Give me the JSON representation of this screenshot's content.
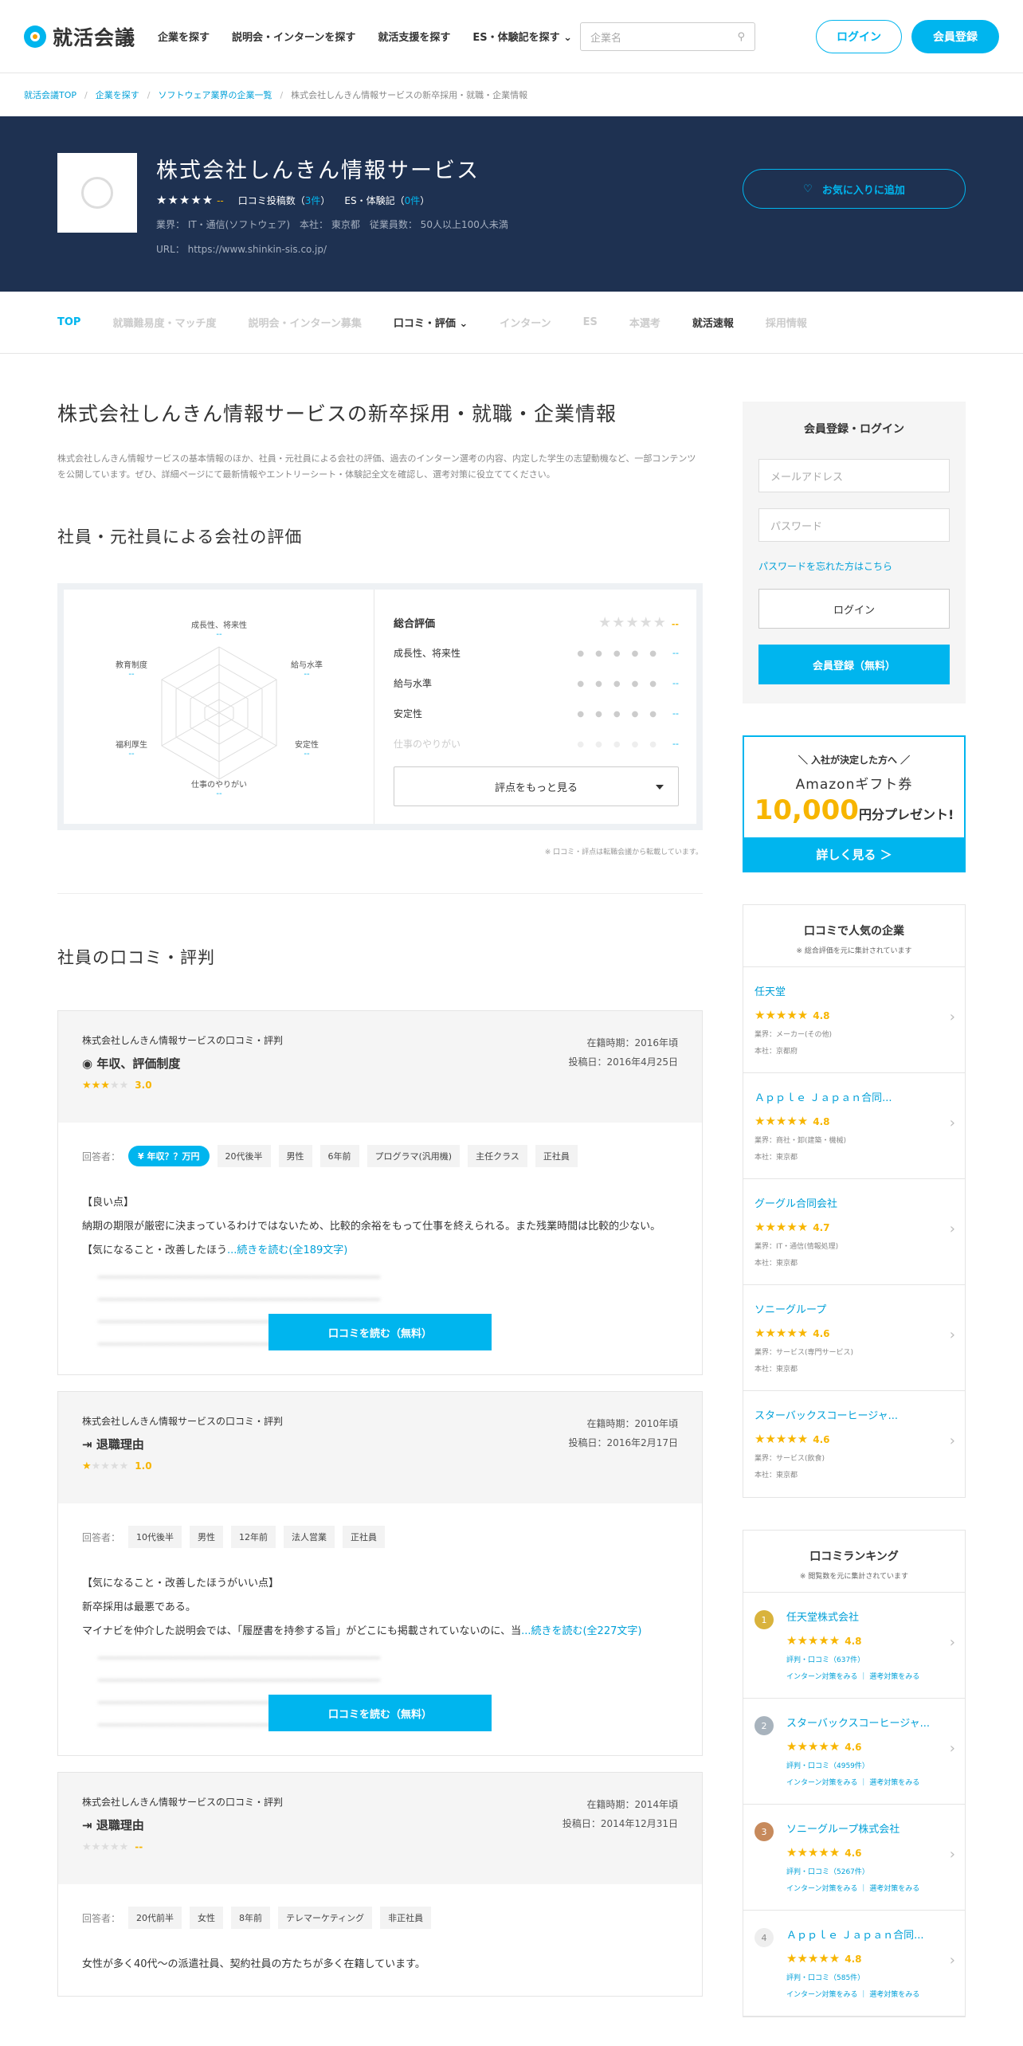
{
  "header": {
    "logo_text": "就活会議",
    "nav": [
      "企業を探す",
      "説明会・インターンを探す",
      "就活支援を探す",
      "ES・体験記を探す"
    ],
    "search_placeholder": "企業名",
    "login": "ログイン",
    "register": "会員登録"
  },
  "breadcrumb": [
    "就活会議TOP",
    "企業を探す",
    "ソフトウェア業界の企業一覧",
    "株式会社しんきん情報サービスの新卒採用・就職・企業情報"
  ],
  "company": {
    "name": "株式会社しんきん情報サービス",
    "rating_stars": "★★★★★",
    "rating_value": "--",
    "review_label": "口コミ投稿数（",
    "review_count": "3件",
    "review_close": "）",
    "es_label": "ES・体験記（",
    "es_count": "0件",
    "es_close": "）",
    "meta": "業界： IT・通信(ソフトウェア)　本社： 東京都　従業員数： 50人以上100人未満",
    "url": "URL： https://www.shinkin-sis.co.jp/",
    "favorite": "お気に入りに追加"
  },
  "tabs": [
    "TOP",
    "就職難易度・マッチ度",
    "説明会・インターン募集",
    "口コミ・評価",
    "インターン",
    "ES",
    "本選考",
    "就活速報",
    "採用情報"
  ],
  "main": {
    "title": "株式会社しんきん情報サービスの新卒採用・就職・企業情報",
    "lead": "株式会社しんきん情報サービスの基本情報のほか、社員・元社員による会社の評価、過去のインターン選考の内容、内定した学生の志望動機など、一部コンテンツを公開しています。ぜひ、詳細ページにて最新情報やエントリーシート・体験記全文を確認し、選考対策に役立ててください。",
    "eval_heading": "社員・元社員による会社の評価",
    "radar_labels": [
      {
        "label": "成長性、将来性",
        "value": "--"
      },
      {
        "label": "給与水準",
        "value": "--"
      },
      {
        "label": "安定性",
        "value": "--"
      },
      {
        "label": "仕事のやりがい",
        "value": "--"
      },
      {
        "label": "福利厚生",
        "value": "--"
      },
      {
        "label": "教育制度",
        "value": "--"
      }
    ],
    "overall_label": "総合評価",
    "overall_value": "--",
    "score_rows": [
      {
        "label": "成長性、将来性",
        "value": "--"
      },
      {
        "label": "給与水準",
        "value": "--"
      },
      {
        "label": "安定性",
        "value": "--"
      },
      {
        "label": "仕事のやりがい",
        "value": "--"
      }
    ],
    "more_button": "評点をもっと見る",
    "note": "※ 口コミ・評点は転職会議から転載しています。",
    "reviews_heading": "社員の口コミ・評判"
  },
  "reviews": [
    {
      "company": "株式会社しんきん情報サービスの口コミ・評判",
      "category": "年収、評価制度",
      "rating": "3.0",
      "tenure": "在籍時期：2016年頃",
      "posted": "投稿日：2016年4月25日",
      "respondent": "回答者：",
      "income": "年収？？万円",
      "tags": [
        "20代後半",
        "男性",
        "6年前",
        "プログラマ(汎用機)",
        "主任クラス",
        "正社員"
      ],
      "text1": "【良い点】",
      "text2": "納期の期限が厳密に決まっているわけではないため、比較的余裕をもって仕事を終えられる。また残業時間は比較的少ない。",
      "text3": "【気になること・改善したほう",
      "read_more": "...続きを読む(全189文字)",
      "button": "口コミを読む（無料）"
    },
    {
      "company": "株式会社しんきん情報サービスの口コミ・評判",
      "category": "退職理由",
      "rating": "1.0",
      "tenure": "在籍時期：2010年頃",
      "posted": "投稿日：2016年2月17日",
      "respondent": "回答者：",
      "tags": [
        "10代後半",
        "男性",
        "12年前",
        "法人営業",
        "正社員"
      ],
      "text1": "【気になること・改善したほうがいい点】",
      "text2": "新卒採用は最悪である。",
      "text3": "マイナビを仲介した説明会では、「履歴書を持参する旨」がどこにも掲載されていないのに、当",
      "read_more": "...続きを読む(全227文字)",
      "button": "口コミを読む（無料）"
    },
    {
      "company": "株式会社しんきん情報サービスの口コミ・評判",
      "category": "退職理由",
      "rating": "--",
      "tenure": "在籍時期：2014年頃",
      "posted": "投稿日：2014年12月31日",
      "respondent": "回答者：",
      "tags": [
        "20代前半",
        "女性",
        "8年前",
        "テレマーケティング",
        "非正社員"
      ],
      "text1": "女性が多く40代～の派遣社員、契約社員の方たちが多く在籍しています。"
    }
  ],
  "sidebar": {
    "login_title": "会員登録・ログイン",
    "email_placeholder": "メールアドレス",
    "password_placeholder": "パスワード",
    "forgot": "パスワードを忘れた方はこちら",
    "login_button": "ログイン",
    "register_button": "会員登録（無料）",
    "amazon": {
      "line1": "＼ 入社が決定した方へ ／",
      "line2": "Amazonギフト券",
      "amount": "10,000",
      "line3": "円分プレゼント!",
      "button": "詳しく見る ＞"
    },
    "popular_title": "口コミで人気の企業",
    "popular_sub": "※ 総合評価を元に集計されています",
    "popular": [
      {
        "name": "任天堂",
        "rating": "4.8",
        "industry": "業界：メーカー(その他)",
        "hq": "本社：京都府"
      },
      {
        "name": "Ａｐｐｌｅ Ｊａｐａｎ合同...",
        "rating": "4.8",
        "industry": "業界：商社・卸(建築・機械)",
        "hq": "本社：東京都"
      },
      {
        "name": "グーグル合同会社",
        "rating": "4.7",
        "industry": "業界：IT・通信(情報処理)",
        "hq": "本社：東京都"
      },
      {
        "name": "ソニーグループ",
        "rating": "4.6",
        "industry": "業界：サービス(専門サービス)",
        "hq": "本社：東京都"
      },
      {
        "name": "スターバックスコーヒージャ...",
        "rating": "4.6",
        "industry": "業界：サービス(飲食)",
        "hq": "本社：東京都"
      }
    ],
    "ranking_title": "口コミランキング",
    "ranking_sub": "※ 閲覧数を元に集計されています",
    "ranking": [
      {
        "rank": "1",
        "name": "任天堂株式会社",
        "rating": "4.8",
        "reviews": "評判・口コミ（637件）",
        "links": "インターン対策をみる ｜ 選考対策をみる"
      },
      {
        "rank": "2",
        "name": "スターバックスコーヒージャ...",
        "rating": "4.6",
        "reviews": "評判・口コミ（4959件）",
        "links": "インターン対策をみる ｜ 選考対策をみる"
      },
      {
        "rank": "3",
        "name": "ソニーグループ株式会社",
        "rating": "4.6",
        "reviews": "評判・口コミ（5267件）",
        "links": "インターン対策をみる ｜ 選考対策をみる"
      },
      {
        "rank": "4",
        "name": "Ａｐｐｌｅ Ｊａｐａｎ合同...",
        "rating": "4.8",
        "reviews": "評判・口コミ（585件）",
        "links": "インターン対策をみる ｜ 選考対策をみる"
      }
    ]
  }
}
